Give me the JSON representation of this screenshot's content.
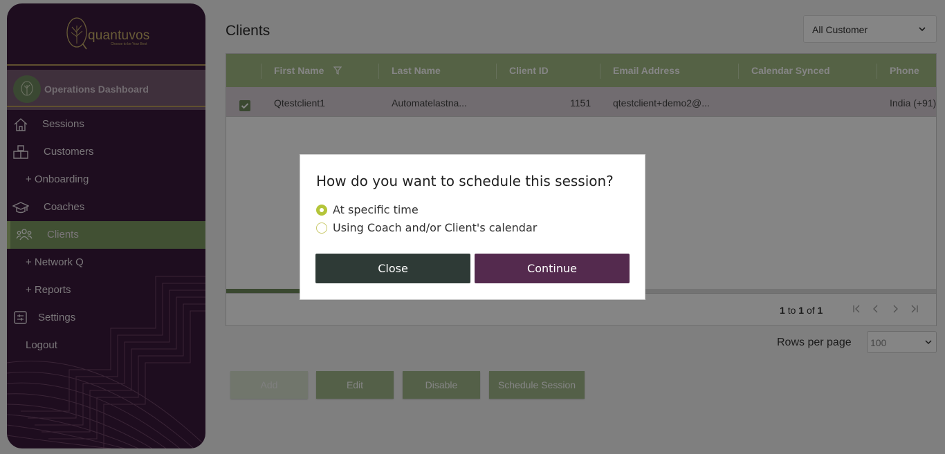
{
  "sidebar": {
    "logo_text": "quantuvos",
    "logo_tagline": "Choose to be Your Best",
    "ops_label": "Operations Dashboard",
    "items": [
      {
        "label": "Sessions"
      },
      {
        "label": "Customers"
      },
      {
        "label": "+ Onboarding"
      },
      {
        "label": "Coaches"
      },
      {
        "label": "Clients"
      },
      {
        "label": "+ Network Q"
      },
      {
        "label": "+ Reports"
      },
      {
        "label": "Settings"
      },
      {
        "label": "Logout"
      }
    ]
  },
  "page": {
    "title": "Clients",
    "filter_value": "All Customer"
  },
  "grid": {
    "columns": [
      "First Name",
      "Last Name",
      "Client ID",
      "Email Address",
      "Calendar Synced",
      "Phone"
    ],
    "row": {
      "first_name": "Qtestclient1",
      "last_name": "Automatelastna...",
      "client_id": "1151",
      "email": "qtestclient+demo2@...",
      "calendar_synced": "",
      "phone": "India (+91)"
    },
    "pager": {
      "from": "1",
      "to_word": "to",
      "to": "1",
      "of_word": "of",
      "total": "1"
    }
  },
  "rows_per_page": {
    "label": "Rows per page",
    "value": "100"
  },
  "actions": {
    "add": "Add",
    "edit": "Edit",
    "disable": "Disable",
    "schedule": "Schedule Session"
  },
  "modal": {
    "title": "How do you want to schedule this session?",
    "option1": "At specific time",
    "option2": "Using Coach and/or Client's calendar",
    "close": "Close",
    "continue": "Continue"
  },
  "colors": {
    "sidebar": "#3a1a3d",
    "accent_green": "#7e9a62",
    "continue_btn": "#542a4e",
    "close_btn": "#2e3a36"
  }
}
